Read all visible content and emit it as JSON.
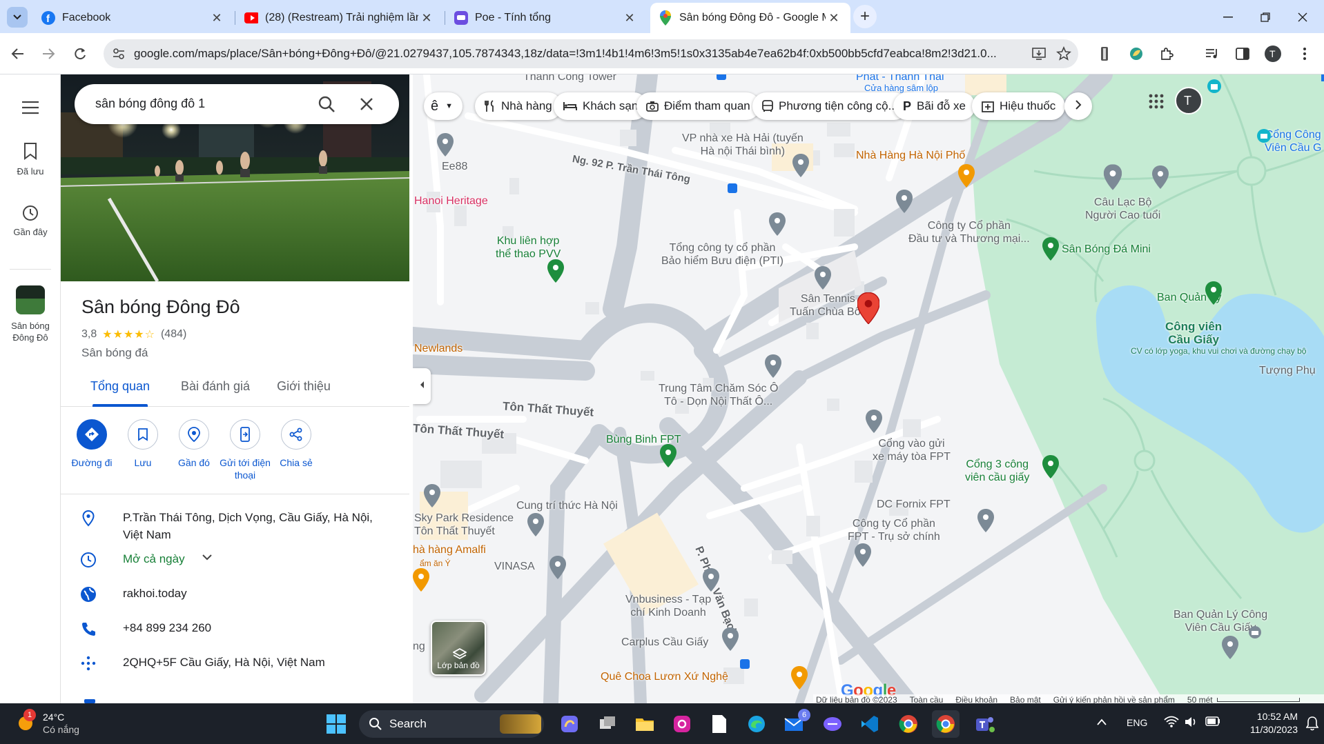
{
  "browser": {
    "tabs": [
      {
        "title": "Facebook",
        "favicon": "facebook-icon",
        "active": false
      },
      {
        "title": "(28) (Restream) Trải nghiệm lần",
        "favicon": "youtube-icon",
        "active": false
      },
      {
        "title": "Poe - Tính tổng",
        "favicon": "poe-icon",
        "active": false
      },
      {
        "title": "Sân bóng Đông Đô - Google M",
        "favicon": "google-maps-icon",
        "active": true
      }
    ],
    "url": "google.com/maps/place/Sân+bóng+Đông+Đô/@21.0279437,105.7874343,18z/data=!3m1!4b1!4m6!3m5!1s0x3135ab4e7ea62b4f:0xb500bb5cfd7eabca!8m2!3d21.0...",
    "profile_initial": "T"
  },
  "rail": {
    "saved": "Đã lưu",
    "recent": "Gần đây",
    "recent_place": "Sân bóng Đông Đô"
  },
  "panel": {
    "search_value": "sân bóng đông đô 1",
    "place_name": "Sân bóng Đông Đô",
    "rating": "3,8",
    "stars": "★★★★☆",
    "reviews": "(484)",
    "category": "Sân bóng đá",
    "tabs": [
      "Tổng quan",
      "Bài đánh giá",
      "Giới thiệu"
    ],
    "actions": [
      {
        "label": "Đường đi",
        "icon": "directions-icon"
      },
      {
        "label": "Lưu",
        "icon": "bookmark-icon"
      },
      {
        "label": "Gần đó",
        "icon": "nearby-icon"
      },
      {
        "label": "Gửi tới điện thoại",
        "icon": "send-to-phone-icon"
      },
      {
        "label": "Chia sẻ",
        "icon": "share-icon"
      }
    ],
    "address": "P.Trần Thái Tông, Dịch Vọng, Cầu Giấy, Hà Nội, Việt Nam",
    "hours": "Mở cả ngày",
    "website": "rakhoi.today",
    "phone": "+84 899 234 260",
    "plus_code": "2QHQ+5F Cầu Giấy, Hà Nội, Việt Nam"
  },
  "map": {
    "chips": [
      "Nhà hàng",
      "Khách sạn",
      "Điểm tham quan",
      "Phương tiện công cộ...",
      "Bãi đỗ xe",
      "Hiệu thuốc"
    ],
    "layer_label": "Lớp bản đồ",
    "profile_initial": "T",
    "labels": {
      "thanh_cong": "Thành Công Tower",
      "phat": "Phát - Thanh Thái",
      "cua_hang": "Cửa hàng sâm lộp",
      "ee88": "Ee88",
      "vp_nha_xe": "VP nhà xe Hà Hải (tuyến\nHà nội Thái bình)",
      "nha_hang_hn": "Nhà Hàng Hà Nội Phố",
      "ng92": "Ng. 92 P. Trần Thái Tông",
      "hanoi_heritage": "Hanoi Heritage",
      "khu_lien_hop": "Khu liên hợp\nthể thao PVV",
      "tong_cong_ty": "Tổng công ty cổ phần\nBảo hiểm Bưu điện (PTI)",
      "cty_cp_dau_tu": "Công ty Cổ phần\nĐầu tư và Thương mại...",
      "cau_lac_bo": "Câu Lạc Bộ\nNgười Cao tuổi",
      "san_bong_mini": "Sân Bóng Đá Mini",
      "cong_cong": "Cổng Công\nViên Cầu G",
      "san_tennis": "Sân Tennis\nTuấn Chùa Bốc",
      "ban_quan_ly": "Ban Quản Lý",
      "cong_vien_cg": "Công viên\nCầu Giấy",
      "cv_desc": "CV có lớp yoga, khu vui chơi và đường chạy bộ",
      "tuong_phu": "Tượng Phụ",
      "newlands": "Newlands",
      "trung_tam": "Trung Tâm Chăm Sóc Ô\nTô - Dọn Nội Thất Ô...",
      "ton_that_thuyet_1": "Tôn Thất Thuyết",
      "ton_that_thuyet_2": "Tôn Thất Thuyết",
      "bung_binh": "Bùng Binh FPT",
      "cong_vao": "Cổng vào gửi\nxe máy tòa FPT",
      "cong3": "Cổng 3 công\nviên cầu giấy",
      "cung_tri_thuc": "Cung trí thức Hà Nội",
      "sky_park": "Sky Park Residence\nTôn Thất Thuyết",
      "dc_fornix": "DC Fornix FPT",
      "cty_fpt": "Công ty Cổ phần\nFPT - Trụ sở chính",
      "amalfi": "hà hàng Amalfi",
      "amalfi_sub": "ẩm ăn Ý",
      "vinasa": "VINASA",
      "p_pham_van_bach": "P. Phạm Văn Bạch",
      "vnbusiness": "Vnbusiness - Tạp\nchí Kinh Doanh",
      "ban_quan_ly_cv": "Ban Quản Lý Công\nViên Cầu Giấy",
      "carplus": "Carplus Cầu Giấy",
      "que_choa": "Quê Choa Lươn Xứ Nghệ",
      "ng": "ng"
    },
    "footer": [
      "Dữ liệu bản đồ ©2023",
      "Toàn cầu",
      "Điều khoản",
      "Bảo mật",
      "Gửi ý kiến phản hồi về sản phẩm",
      "50 mét"
    ],
    "logo": "Google"
  },
  "taskbar": {
    "weather_temp": "24°C",
    "weather_desc": "Có nắng",
    "weather_badge": "1",
    "search": "Search",
    "lang": "ENG",
    "time": "10:52 AM",
    "date": "11/30/2023",
    "mail_badge": "6"
  },
  "colors": {
    "accent": "#0b57d0",
    "tabstrip": "#d3e3fd",
    "park": "#c5ebd3",
    "water": "#a8dcf5",
    "road": "#c8ced6"
  }
}
